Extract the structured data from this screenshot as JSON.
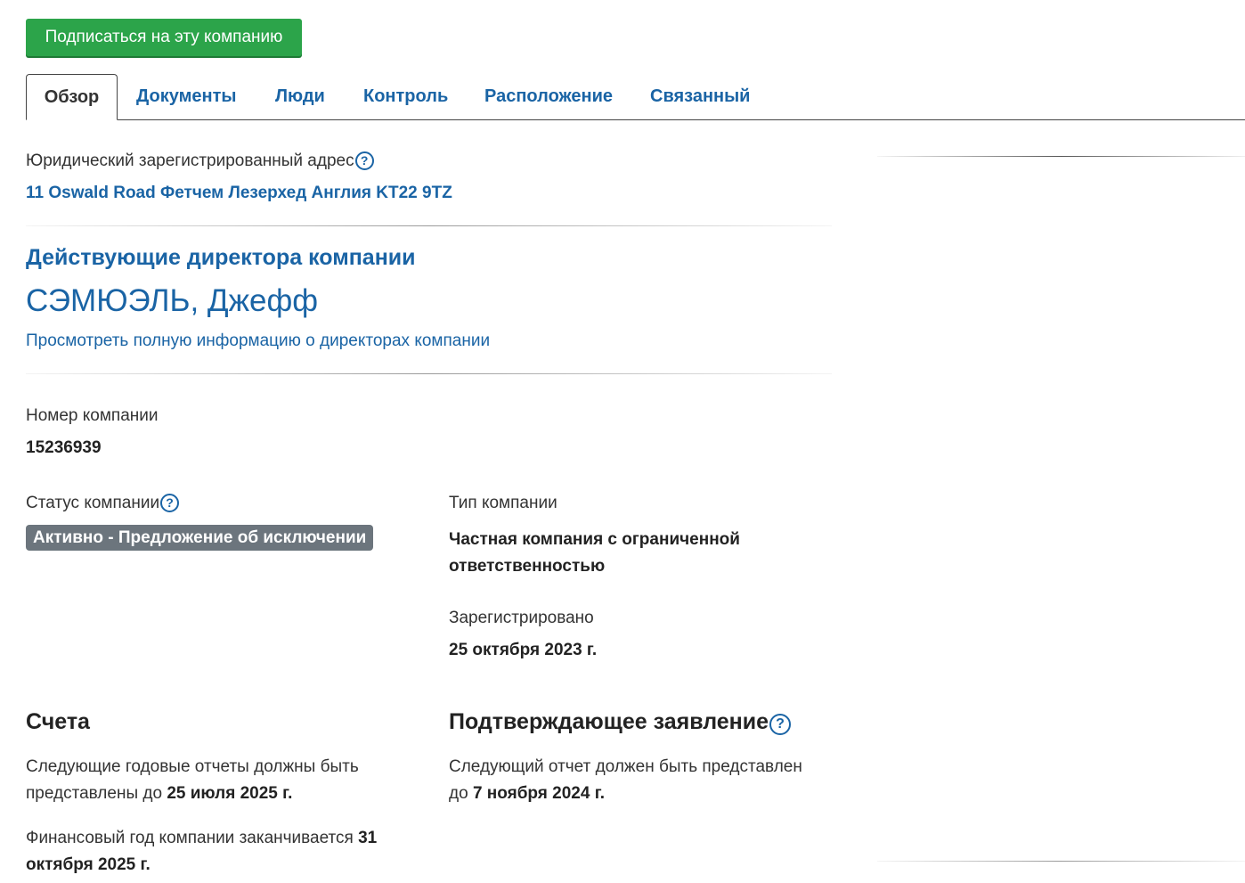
{
  "follow_button": "Подписаться на эту компанию",
  "tabs": [
    {
      "label": "Обзор",
      "active": true
    },
    {
      "label": "Документы"
    },
    {
      "label": "Люди"
    },
    {
      "label": "Контроль"
    },
    {
      "label": "Расположение"
    },
    {
      "label": "Связанный"
    }
  ],
  "address": {
    "label": "Юридический зарегистрированный адрес",
    "value": "11 Oswald Road Фетчем Лезерхед Англия KT22 9TZ"
  },
  "directors": {
    "heading": "Действующие директора компании",
    "name": "СЭМЮЭЛЬ, Джефф",
    "link": "Просмотреть полную информацию о директорах компании"
  },
  "company_number": {
    "label": "Номер компании",
    "value": "15236939"
  },
  "company_status": {
    "label": "Статус компании",
    "value": "Активно - Предложение об исключении"
  },
  "company_type": {
    "label": "Тип компании",
    "value_line1": "Частная компания с ограниченной",
    "value_line2": "ответственностью"
  },
  "incorporated": {
    "label": "Зарегистрировано",
    "value": "25 октября 2023 г."
  },
  "accounts": {
    "heading": "Счета",
    "next_text_1": "Следующие годовые отчеты должны быть",
    "next_text_2": "представлены до",
    "next_date": "25 июля 2025 г.",
    "fy_text": "Финансовый год компании заканчивается",
    "fy_date_1": "31",
    "fy_date_2": "октября 2025 г."
  },
  "confirmation": {
    "heading": "Подтверждающее заявление",
    "text_1": "Следующий отчет должен быть представлен",
    "text_2": "до",
    "date": "7 ноября 2024 г."
  },
  "icons": {
    "help": "question-circle-icon"
  },
  "colors": {
    "follow_button": "#2ca44a",
    "link": "#1a64a5",
    "status_badge": "#6c757d"
  }
}
